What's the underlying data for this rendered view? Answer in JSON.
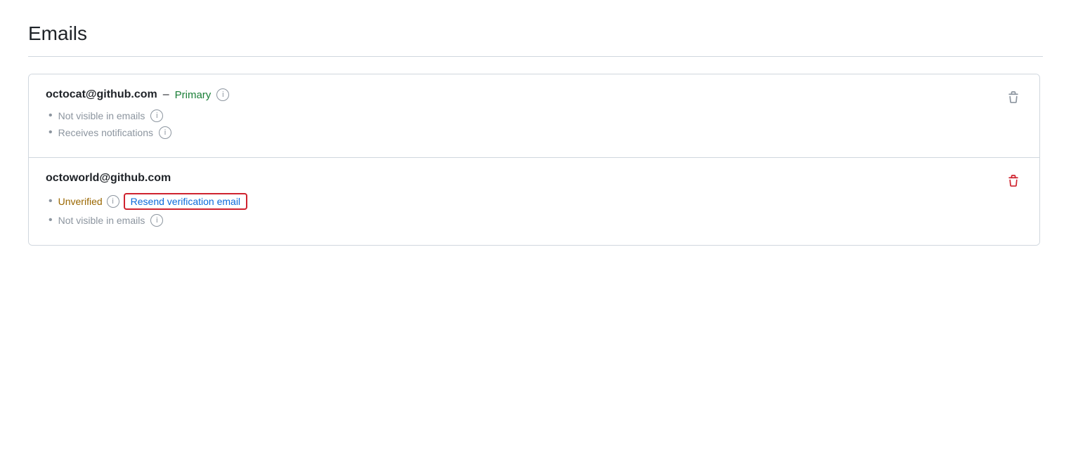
{
  "page": {
    "title": "Emails"
  },
  "emails": [
    {
      "id": "email-1",
      "address": "octocat@github.com",
      "is_primary": true,
      "primary_label": "Primary",
      "separator": "–",
      "details": [
        {
          "text": "Not visible in emails",
          "has_info": true
        },
        {
          "text": "Receives notifications",
          "has_info": true
        }
      ],
      "delete_danger": false
    },
    {
      "id": "email-2",
      "address": "octoworld@github.com",
      "is_primary": false,
      "details": [
        {
          "text": "Unverified",
          "is_unverified": true,
          "has_info": true,
          "resend_label": "Resend verification email"
        },
        {
          "text": "Not visible in emails",
          "has_info": true
        }
      ],
      "delete_danger": true
    }
  ],
  "icons": {
    "info": "i",
    "trash": "🗑"
  }
}
